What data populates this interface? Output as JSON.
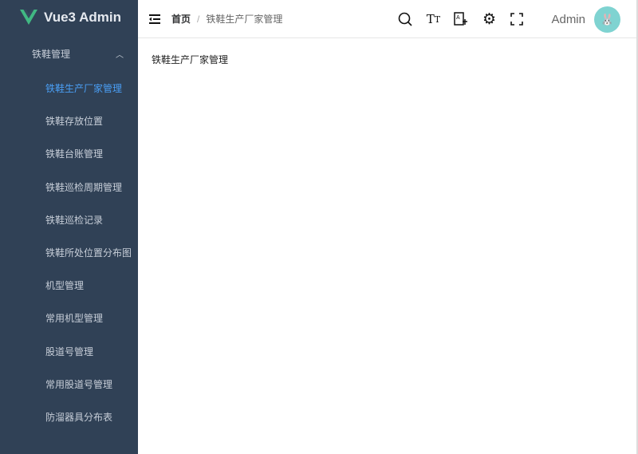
{
  "app": {
    "title": "Vue3 Admin",
    "accent": "#41b883"
  },
  "sidebar": {
    "parent": "铁鞋管理",
    "items": [
      {
        "label": "铁鞋生产厂家管理",
        "active": true
      },
      {
        "label": "铁鞋存放位置"
      },
      {
        "label": "铁鞋台账管理"
      },
      {
        "label": "铁鞋巡检周期管理"
      },
      {
        "label": "铁鞋巡检记录"
      },
      {
        "label": "铁鞋所处位置分布图"
      },
      {
        "label": "机型管理"
      },
      {
        "label": "常用机型管理"
      },
      {
        "label": "股道号管理"
      },
      {
        "label": "常用股道号管理"
      },
      {
        "label": "防溜器具分布表"
      }
    ]
  },
  "header": {
    "breadcrumb": {
      "home": "首页",
      "sep": "/",
      "current": "铁鞋生产厂家管理"
    },
    "user": "Admin"
  },
  "main": {
    "title": "铁鞋生产厂家管理"
  }
}
